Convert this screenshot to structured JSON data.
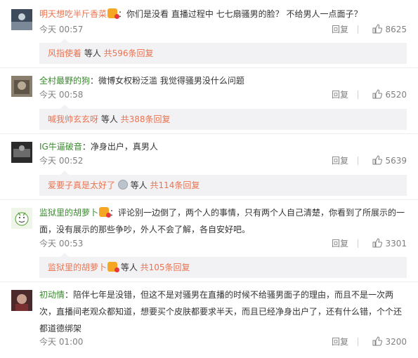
{
  "comments": [
    {
      "user": "明天想吃半斤香菜",
      "text": "：你们是没看 直播过程中 七七扇骚男的脸？ 不给男人一点面子？",
      "time": "今天 00:57",
      "reply_label": "回复",
      "likes": "8625",
      "sub": {
        "name": "风指使着",
        "etc": " 等人 ",
        "total": "共596条回复"
      }
    },
    {
      "user": "全村最野的狗",
      "text": "：微博女权粉泛滥 我觉得骚男没什么问题",
      "time": "今天 00:58",
      "reply_label": "回复",
      "likes": "6520",
      "sub": {
        "name": "喊我帅玄玄呀",
        "etc": " 等人 ",
        "total": "共388条回复"
      }
    },
    {
      "user": "IG牛逼破音",
      "text": "：净身出户，真男人",
      "time": "今天 00:52",
      "reply_label": "回复",
      "likes": "5639",
      "sub": {
        "name": "爱要子真是太好了",
        "etc": " 等人 ",
        "total": "共114条回复"
      }
    },
    {
      "user": "监狱里的胡萝卜",
      "text": "：评论别一边倒了，两个人的事情，只有两个人自己清楚，你看到了所展示的一面，没有展示的那些争吵，外人不会了解，各自安好吧。",
      "time": "今天 00:53",
      "reply_label": "回复",
      "likes": "3301",
      "sub": {
        "name": "监狱里的胡萝卜",
        "etc": " 等人 ",
        "total": "共105条回复"
      }
    },
    {
      "user": "初动情",
      "text": "：陪伴七年是没错，但这不是对骚男在直播的时候不给骚男面子的理由，而且不是一次两次，直播间老观众都知道，想要买个皮肤都要求半天，而且已经净身出户了，还有什么错，个个还都道德绑架",
      "time": "今天 01:00",
      "reply_label": "回复",
      "likes": "3200"
    }
  ],
  "colors": {
    "link": "#eb7350",
    "muted": "#808080",
    "sub_bg": "#f2f2f5"
  }
}
